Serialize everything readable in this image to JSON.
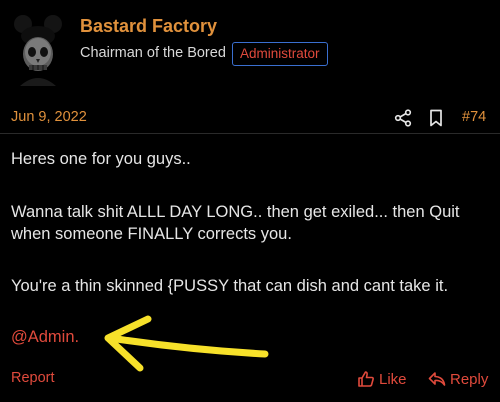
{
  "author": {
    "name": "Bastard Factory",
    "title": "Chairman of the Bored",
    "role_badge": "Administrator"
  },
  "post": {
    "date": "Jun 9, 2022",
    "number": "#74",
    "paragraphs": [
      "Heres one for you guys..",
      "Wanna talk shit ALLL DAY LONG.. then get exiled... then Quit when someone FINALLY corrects you.",
      "You're a thin skinned {PUSSY that can dish and cant take it."
    ],
    "mention": "@Admin."
  },
  "actions": {
    "report_label": "Report",
    "like_label": "Like",
    "reply_label": "Reply"
  },
  "icons": {
    "share": "share-icon",
    "bookmark": "bookmark-icon",
    "like": "thumbs-up-icon",
    "reply": "reply-icon"
  },
  "colors": {
    "background": "#000000",
    "username": "#e0913c",
    "accent_red": "#e04a3c",
    "badge_border": "#3a6fd0",
    "text": "#e6e6e6",
    "arrow": "#f7e12a"
  }
}
